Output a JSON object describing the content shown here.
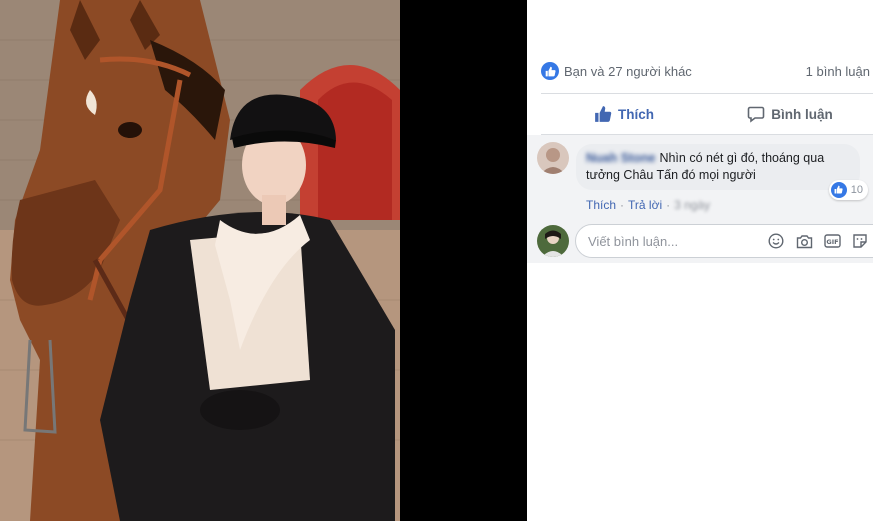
{
  "reactions": {
    "count_text": "Bạn và 27 người khác",
    "comments_count_text": "1 bình luận"
  },
  "actions": {
    "like_label": "Thích",
    "comment_label": "Bình luận"
  },
  "comment": {
    "author": "Nuah Stone",
    "text": "Nhìn có nét gì đó, thoáng qua tưởng Châu Tấn đó mọi người",
    "like_count": "10",
    "like_link": "Thích",
    "reply_link": "Trả lời",
    "separator": "·",
    "time": "3 ngày"
  },
  "composer": {
    "placeholder": "Viết bình luận..."
  },
  "icons": {
    "like": "thumbs-up-icon",
    "comment": "speech-bubble-icon",
    "emoji": "smiley-icon",
    "camera": "camera-icon",
    "gif": "gif-icon",
    "sticker": "sticker-icon"
  },
  "colors": {
    "accent": "#4267b2",
    "like_badge": "#3578e5",
    "muted_text": "#606770",
    "comment_bg": "#f2f3f5"
  }
}
